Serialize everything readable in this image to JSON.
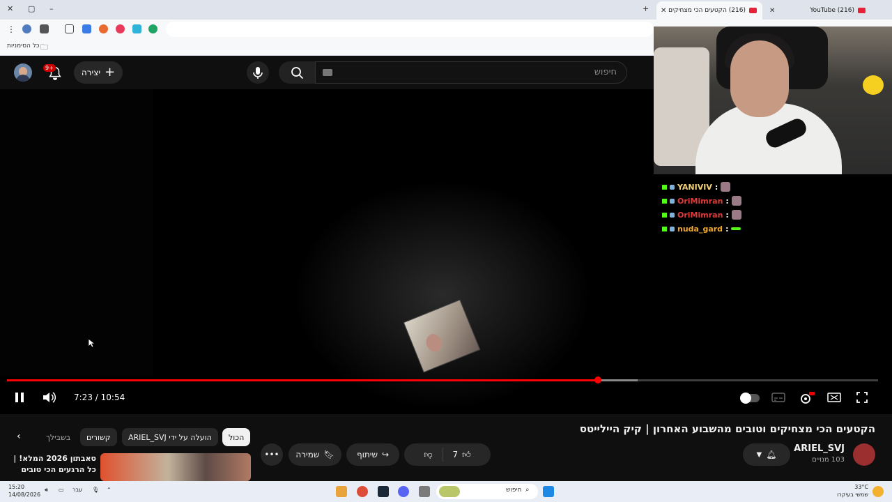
{
  "browser": {
    "tabs": [
      {
        "title": "(216) YouTube"
      },
      {
        "title": "(216) הקטעים הכי מצחיקים"
      }
    ],
    "bookmarks_label": "כל הסימניות"
  },
  "yt_header": {
    "search_placeholder": "חיפוש",
    "create_label": "יצירה",
    "notifications_badge": "9+"
  },
  "player": {
    "time_current": "7:23",
    "time_total": "10:54",
    "progress_fraction": 0.678,
    "buffer_fraction": 0.724,
    "chat": [
      {
        "user": "YANIVIV",
        "color": "#f3d27a"
      },
      {
        "user": "OriMimran",
        "color": "#e23b3b"
      },
      {
        "user": "OriMimran",
        "color": "#e23b3b"
      },
      {
        "user": "nuda_gard",
        "color": "#f0a830"
      }
    ]
  },
  "video": {
    "title": "הקטעים הכי מצחיקים וטובים מהשבוע האחרון | קיק היילייטס",
    "channel": "ARIEL_SVJ",
    "subscribers": "103 מנויים",
    "likes": "7",
    "share_label": "שיתוף",
    "save_label": "שמירה"
  },
  "chips": {
    "all": "הכול",
    "uploaded_by": "הועלה על ידי ARIEL_SVJ",
    "related": "קשורים",
    "for_you": "בשבילך"
  },
  "recommendation": {
    "title": "סאבתון 2026 המלא! | כל הרגעים הכי טובים"
  },
  "taskbar": {
    "search_placeholder": "חיפוש",
    "time": "15:20",
    "date": "14/08/2026",
    "language": "עבר",
    "weather_temp": "33°C",
    "weather_desc": "שמשי בעיקרו"
  }
}
